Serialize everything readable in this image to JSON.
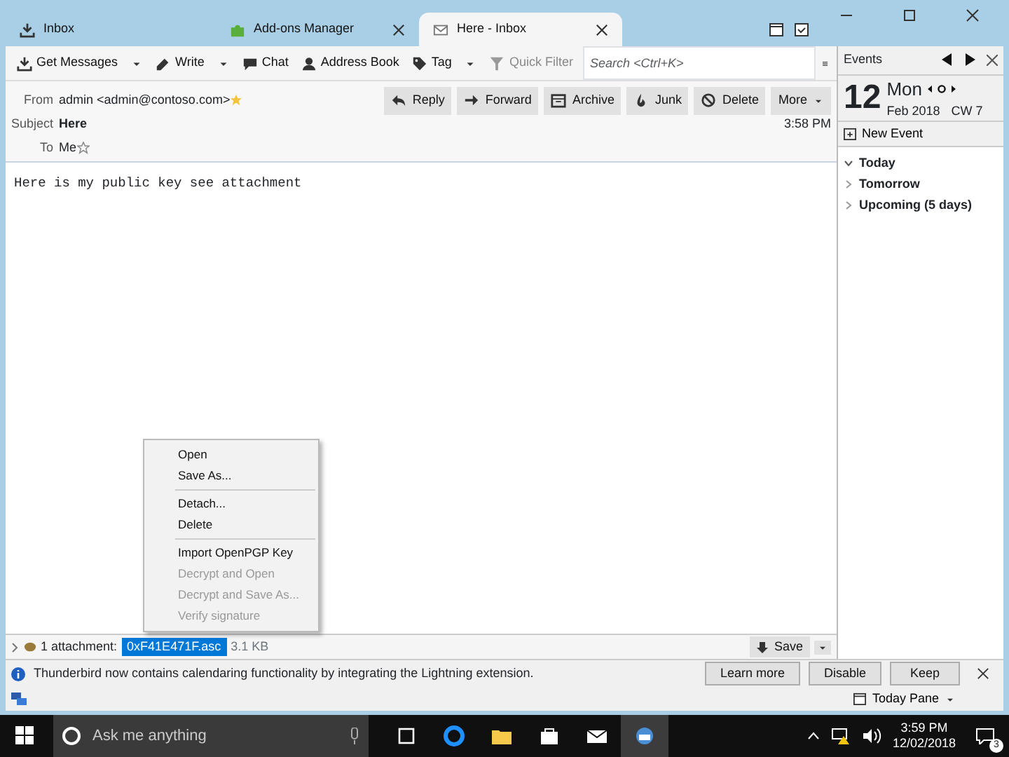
{
  "tabs": [
    {
      "label": "Inbox",
      "selected": false
    },
    {
      "label": "Add-ons Manager",
      "selected": false
    },
    {
      "label": "Here - Inbox",
      "selected": true
    }
  ],
  "toolbar": [
    "Get Messages",
    "Write",
    "Chat",
    "Address Book",
    "Tag",
    "Quick Filter"
  ],
  "search": {
    "placeholder": "Search <Ctrl+K>"
  },
  "message": {
    "from_label": "From",
    "from": "admin <admin@contoso.com>",
    "subject_label": "Subject",
    "subject": "Here",
    "to_label": "To",
    "to": "Me",
    "time": "3:58 PM",
    "body": "Here is my public key see attachment",
    "actions": [
      "Reply",
      "Forward",
      "Archive",
      "Junk",
      "Delete",
      "More"
    ]
  },
  "context_menu": [
    {
      "label": "Open",
      "disabled": false,
      "separator_after": false
    },
    {
      "label": "Save As...",
      "disabled": false,
      "separator_after": true
    },
    {
      "label": "Detach...",
      "disabled": false,
      "separator_after": false
    },
    {
      "label": "Delete",
      "disabled": false,
      "separator_after": true
    },
    {
      "label": "Import OpenPGP Key",
      "disabled": false,
      "separator_after": false
    },
    {
      "label": "Decrypt and Open",
      "disabled": true,
      "separator_after": false
    },
    {
      "label": "Decrypt and Save As...",
      "disabled": true,
      "separator_after": false
    },
    {
      "label": "Verify signature",
      "disabled": true,
      "separator_after": false
    }
  ],
  "attachment_bar": {
    "count": "1 attachment:",
    "filename": "0xF41E471F.asc",
    "size": "3.1 KB",
    "save": "Save"
  },
  "notification": {
    "text": "Thunderbird now contains calendaring functionality by integrating the Lightning extension.",
    "buttons": [
      "Learn more",
      "Disable",
      "Keep"
    ]
  },
  "status_bar": {
    "today_pane": "Today Pane"
  },
  "today_pane": {
    "title": "Events",
    "day": "12",
    "weekday": "Mon",
    "month": "Feb 2018",
    "week": "CW 7",
    "new_event": "New Event",
    "groups": [
      {
        "label": "Today",
        "expanded": true
      },
      {
        "label": "Tomorrow",
        "expanded": false
      },
      {
        "label": "Upcoming (5 days)",
        "expanded": false
      }
    ]
  },
  "taskbar": {
    "search_placeholder": "Ask me anything",
    "time": "3:59 PM",
    "date": "12/02/2018",
    "notifications": "3"
  }
}
